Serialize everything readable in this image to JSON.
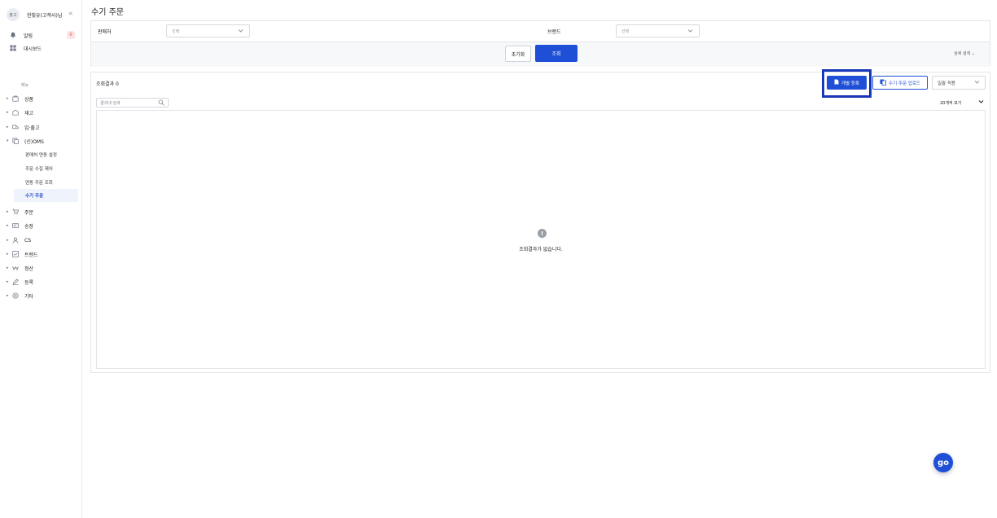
{
  "profile": {
    "avatar": "출고",
    "name": "한빛유(고객사)님"
  },
  "sidebar": {
    "alarm": {
      "label": "알림",
      "count": "0"
    },
    "dashboard": "대시보드",
    "menu_heading": "메뉴",
    "nav": [
      {
        "label": "상품",
        "icon": "box-icon"
      },
      {
        "label": "재고",
        "icon": "warehouse-icon"
      },
      {
        "label": "입·출고",
        "icon": "truck-icon"
      },
      {
        "label": "(신)OMS",
        "icon": "oms-icon"
      }
    ],
    "oms_sub": [
      "판매처 연동 설정",
      "주문 수집 제어",
      "연동 주문 조회",
      "수기 주문"
    ],
    "nav2": [
      {
        "label": "주문",
        "icon": "cart-icon"
      },
      {
        "label": "송장",
        "icon": "invoice-icon"
      },
      {
        "label": "CS",
        "icon": "person-icon"
      },
      {
        "label": "트렌드",
        "icon": "trend-icon"
      },
      {
        "label": "정산",
        "icon": "won-icon"
      },
      {
        "label": "등록",
        "icon": "pencil-icon"
      },
      {
        "label": "기타",
        "icon": "settings-icon"
      }
    ]
  },
  "page": {
    "title": "수기 주문"
  },
  "filter": {
    "seller_label": "판매처",
    "seller_value": "선택",
    "brand_label": "브랜드",
    "brand_value": "선택",
    "reset": "초기화",
    "search": "조회",
    "detail": "상세 검색"
  },
  "result": {
    "count_label": "조회결과 0",
    "individual_btn": "개별 등록",
    "upload_btn": "수기 주문 업로드",
    "bulk_select": "일괄 적용",
    "search_placeholder": "결과내 검색",
    "per_page": "20개씩 보기",
    "empty_message": "조회결과가 없습니다."
  },
  "fab": {
    "label": "go"
  },
  "colors": {
    "primary": "#1f4fd6",
    "highlight": "#1736b8"
  }
}
